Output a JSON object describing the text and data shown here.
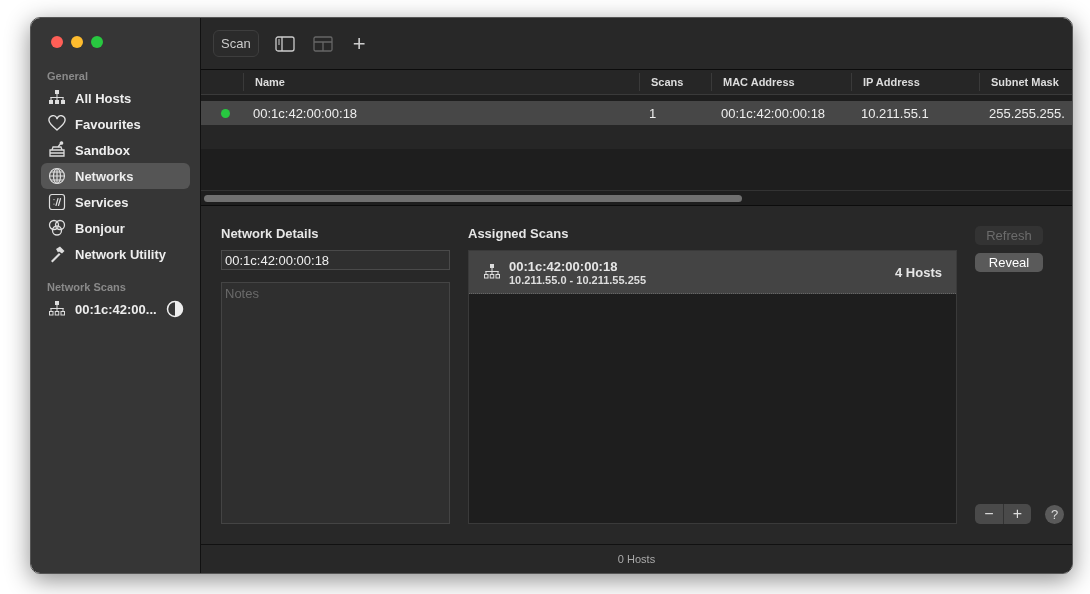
{
  "window": {
    "controls": [
      {
        "color": "#ff5f57"
      },
      {
        "color": "#febc2e"
      },
      {
        "color": "#28c840"
      }
    ]
  },
  "sidebar": {
    "sections": [
      {
        "title": "General",
        "items": [
          {
            "label": "All Hosts",
            "selected": false
          },
          {
            "label": "Favourites",
            "selected": false
          },
          {
            "label": "Sandbox",
            "selected": false
          },
          {
            "label": "Networks",
            "selected": true
          },
          {
            "label": "Services",
            "selected": false
          },
          {
            "label": "Bonjour",
            "selected": false
          },
          {
            "label": "Network Utility",
            "selected": false
          }
        ]
      },
      {
        "title": "Network Scans",
        "items": [
          {
            "label": "00:1c:42:00...",
            "selected": false,
            "level": 0.5
          }
        ]
      }
    ]
  },
  "toolbar": {
    "scan_button": "Scan",
    "add_button": "+"
  },
  "table": {
    "columns": [
      "",
      "Name",
      "Scans",
      "MAC Address",
      "IP Address",
      "Subnet Mask"
    ],
    "rows": [
      {
        "color": "#28c840",
        "selected": true,
        "cells": [
          "",
          "00:1c:42:00:00:18",
          "1",
          "00:1c:42:00:00:18",
          "10.211.55.1",
          "255.255.255."
        ]
      }
    ]
  },
  "details": {
    "title": "Network Details",
    "name_value": "00:1c:42:00:00:18",
    "notes_placeholder": "Notes"
  },
  "assigned": {
    "title": "Assigned Scans",
    "items": [
      {
        "name": "00:1c:42:00:00:18",
        "range": "10.211.55.0 - 10.211.55.255",
        "hosts": "4 Hosts",
        "selected": true
      }
    ],
    "buttons": [
      {
        "label": "Refresh",
        "disabled": true
      },
      {
        "label": "Reveal",
        "disabled": false
      }
    ],
    "bottom_buttons": [
      "−",
      "+",
      "?"
    ]
  },
  "status_bar": "0 Hosts"
}
